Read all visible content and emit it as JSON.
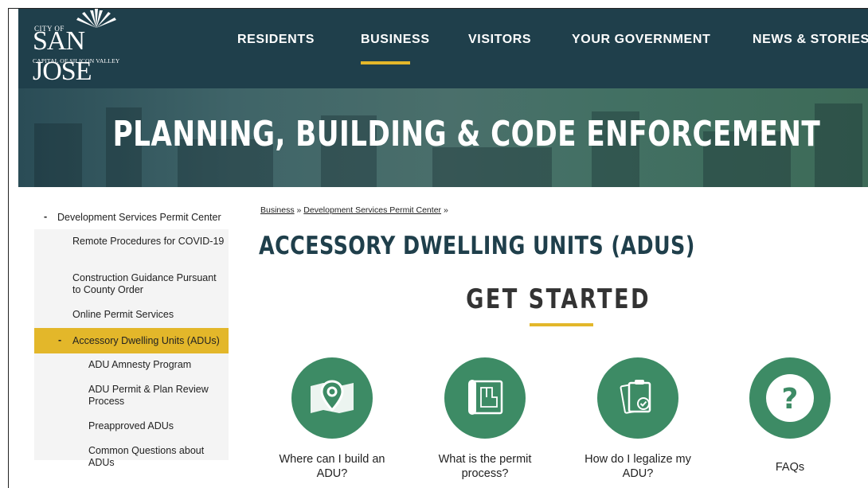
{
  "logo": {
    "city_of": "CITY OF",
    "name": "SAN JOSE",
    "tagline": "CAPITAL OF SILICON VALLEY"
  },
  "nav": {
    "items": [
      "RESIDENTS",
      "BUSINESS",
      "VISITORS",
      "YOUR GOVERNMENT",
      "NEWS & STORIES"
    ],
    "active": "BUSINESS"
  },
  "hero": {
    "title": "PLANNING, BUILDING & CODE ENFORCEMENT"
  },
  "sidebar": {
    "items": [
      {
        "label": "Development Services Permit Center",
        "dash": "-"
      },
      {
        "label": "Remote Procedures for COVID-19"
      },
      {
        "label": "Construction Guidance Pursuant to County Order"
      },
      {
        "label": "Online Permit Services"
      },
      {
        "label": "Accessory Dwelling Units (ADUs)",
        "dash": "-",
        "active": true
      },
      {
        "label": "ADU Amnesty Program"
      },
      {
        "label": "ADU Permit & Plan Review Process"
      },
      {
        "label": "Preapproved ADUs"
      },
      {
        "label": "Common Questions about ADUs"
      }
    ]
  },
  "breadcrumb": {
    "items": [
      "Business",
      "Development Services Permit Center"
    ],
    "separator": "»"
  },
  "page": {
    "title": "ACCESSORY DWELLING UNITS (ADUS)",
    "section_heading": "GET STARTED"
  },
  "cards": [
    {
      "label": "Where can I build an ADU?",
      "icon": "map-pin-icon"
    },
    {
      "label": "What is the permit process?",
      "icon": "blueprint-icon"
    },
    {
      "label": "How do I legalize my ADU?",
      "icon": "clipboard-check-icon"
    },
    {
      "label": "FAQs",
      "icon": "question-icon"
    }
  ],
  "colors": {
    "nav_bg": "#1f3f4b",
    "accent": "#e3b72a",
    "green": "#3d8b65",
    "title": "#1f3f4b"
  }
}
